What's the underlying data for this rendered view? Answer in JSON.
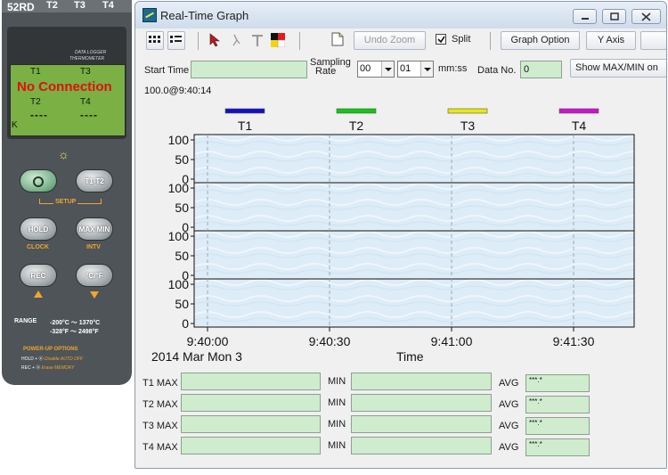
{
  "device": {
    "model": "52RD",
    "channels": [
      "T2",
      "T3",
      "T4"
    ],
    "brand_line1": "DATA LOGGER",
    "brand_line2": "THERMOMETER",
    "lcd": {
      "t1": "T1",
      "t3": "T3",
      "t2": "T2",
      "t4": "T4",
      "status": "No Connection",
      "dash_left": "----",
      "dash_right": "----",
      "unit": "K"
    },
    "buttons": {
      "t1t2": "T1-T2",
      "setup": "SETUP",
      "hold": "HOLD",
      "clock": "CLOCK",
      "maxmin": "MAX MIN",
      "intv": "INTV",
      "rec": "REC",
      "unit_toggle": "°C/°F"
    },
    "range_label": "RANGE",
    "range_c": "-200°C ～ 1370°C",
    "range_f": "-328°F ～ 2498°F",
    "powerup_label": "POWER-UP OPTIONS",
    "opt1_keys": "HOLD + ⓟ",
    "opt1_text": "Disable AUTO OFF",
    "opt2_keys": "REC + ⓟ",
    "opt2_text": "Erase MEMORY"
  },
  "window": {
    "title": "Real-Time Graph"
  },
  "toolbar": {
    "undo_zoom": "Undo Zoom",
    "split_label": "Split",
    "split_checked": true,
    "graph_option": "Graph Option",
    "y_axis": "Y Axis"
  },
  "controls": {
    "start_time_label": "Start Time",
    "start_time_value": "",
    "sampling_label1": "Sampling",
    "sampling_label2": "Rate",
    "sampling_min": "00",
    "sampling_sec": "01",
    "sampling_unit": "mm:ss",
    "data_no_label": "Data No.",
    "data_no_value": "0",
    "show_maxmin": "Show MAX/MIN on"
  },
  "chart_data": {
    "type": "line",
    "stamp": "100.0@9:40:14",
    "series": [
      {
        "name": "T1",
        "color": "#1010c8",
        "values": []
      },
      {
        "name": "T2",
        "color": "#10c810",
        "values": []
      },
      {
        "name": "T3",
        "color": "#e8e810",
        "values": []
      },
      {
        "name": "T4",
        "color": "#d010d0",
        "values": []
      }
    ],
    "panels": 4,
    "yticks": [
      "100",
      "50",
      "0"
    ],
    "ylim": [
      0,
      100
    ],
    "xticks": [
      "9:40:00",
      "9:40:30",
      "9:41:00",
      "9:41:30"
    ],
    "xlabel": "Time",
    "date": "2014 Mar Mon 3",
    "grid": true
  },
  "stats": {
    "rows": [
      {
        "label": "T1 MAX",
        "max": "",
        "min_label": "MIN",
        "min": "",
        "avg_label": "AVG",
        "avg": "***.*"
      },
      {
        "label": "T2 MAX",
        "max": "",
        "min_label": "MIN",
        "min": "",
        "avg_label": "AVG",
        "avg": "***.*"
      },
      {
        "label": "T3 MAX",
        "max": "",
        "min_label": "MIN",
        "min": "",
        "avg_label": "AVG",
        "avg": "***.*"
      },
      {
        "label": "T4 MAX",
        "max": "",
        "min_label": "MIN",
        "min": "",
        "avg_label": "AVG",
        "avg": "***.*"
      }
    ]
  }
}
